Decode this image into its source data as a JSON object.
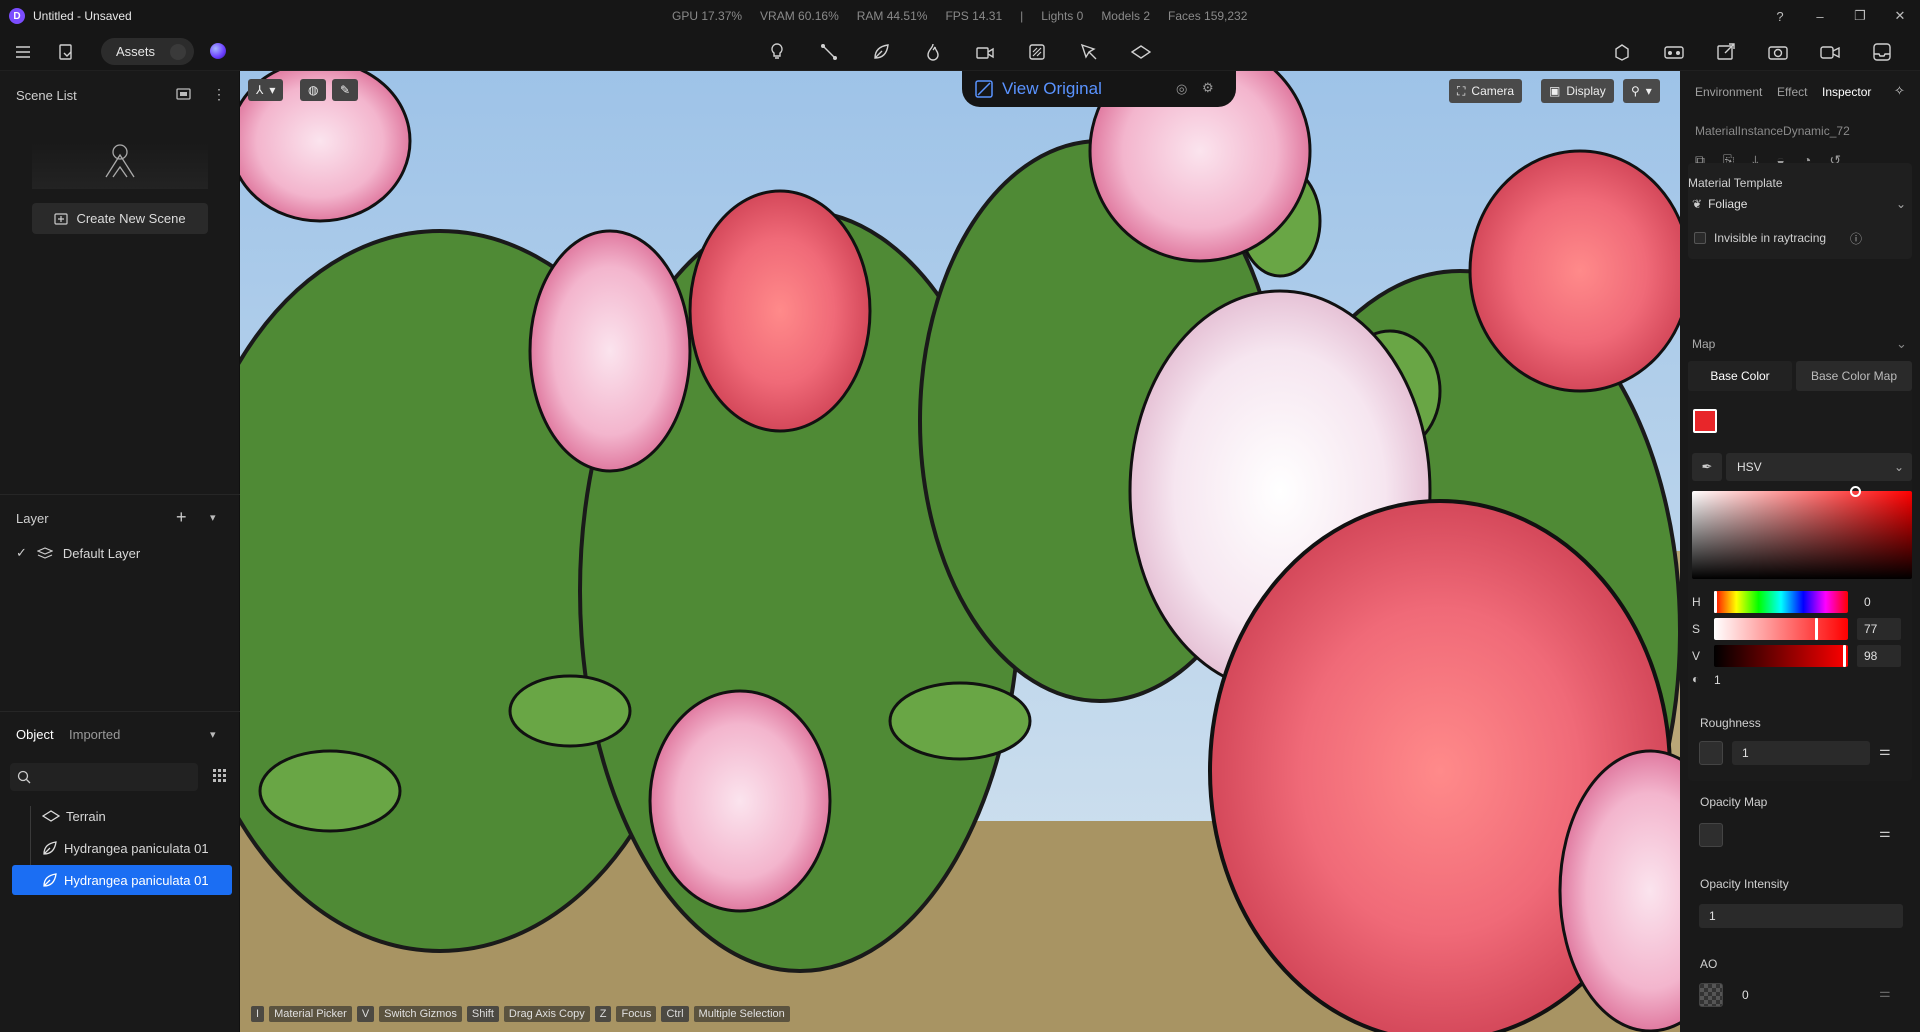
{
  "app": {
    "title": "Untitled - Unsaved",
    "logo_letter": "D"
  },
  "stats": [
    "GPU 17.37%",
    "VRAM 60.16%",
    "RAM 44.51%",
    "FPS 14.31",
    "|",
    "Lights 0",
    "Models 2",
    "Faces 159,232"
  ],
  "toolbar": {
    "assets_label": "Assets"
  },
  "scene_list": {
    "title": "Scene List",
    "create_label": "Create New Scene"
  },
  "layer": {
    "title": "Layer",
    "items": [
      {
        "label": "Default Layer"
      }
    ]
  },
  "objects": {
    "tab_object": "Object",
    "tab_imported": "Imported",
    "items": [
      {
        "label": "Terrain"
      },
      {
        "label": "Hydrangea paniculata 01"
      },
      {
        "label": "Hydrangea paniculata 01"
      }
    ]
  },
  "viewport": {
    "view_original": "View Original",
    "camera_label": "Camera",
    "display_label": "Display",
    "shortcuts": [
      {
        "key": "I",
        "text": "Material Picker"
      },
      {
        "key": "V",
        "text": "Switch Gizmos"
      },
      {
        "key": "Shift",
        "text": "Drag Axis Copy"
      },
      {
        "key": "Z",
        "text": "Focus"
      },
      {
        "key": "Ctrl",
        "text": "Multiple Selection"
      }
    ]
  },
  "inspector": {
    "tabs": [
      "Environment",
      "Effect",
      "Inspector"
    ],
    "material_name": "MaterialInstanceDynamic_72",
    "template_label": "Material Template",
    "template_value": "Foliage",
    "invisible_label": "Invisible in raytracing",
    "map_label": "Map",
    "base_color_tab": "Base Color",
    "base_color_map_tab": "Base Color Map",
    "color_mode": "HSV",
    "base_color": "#e8262a",
    "h_label": "H",
    "h_value": "0",
    "s_label": "S",
    "s_value": "77",
    "v_label": "V",
    "v_value": "98",
    "alpha_value": "1",
    "roughness_label": "Roughness",
    "roughness_value": "1",
    "opacity_map_label": "Opacity Map",
    "opacity_intensity_label": "Opacity Intensity",
    "opacity_intensity_value": "1",
    "ao_label": "AO",
    "ao_value": "0"
  }
}
